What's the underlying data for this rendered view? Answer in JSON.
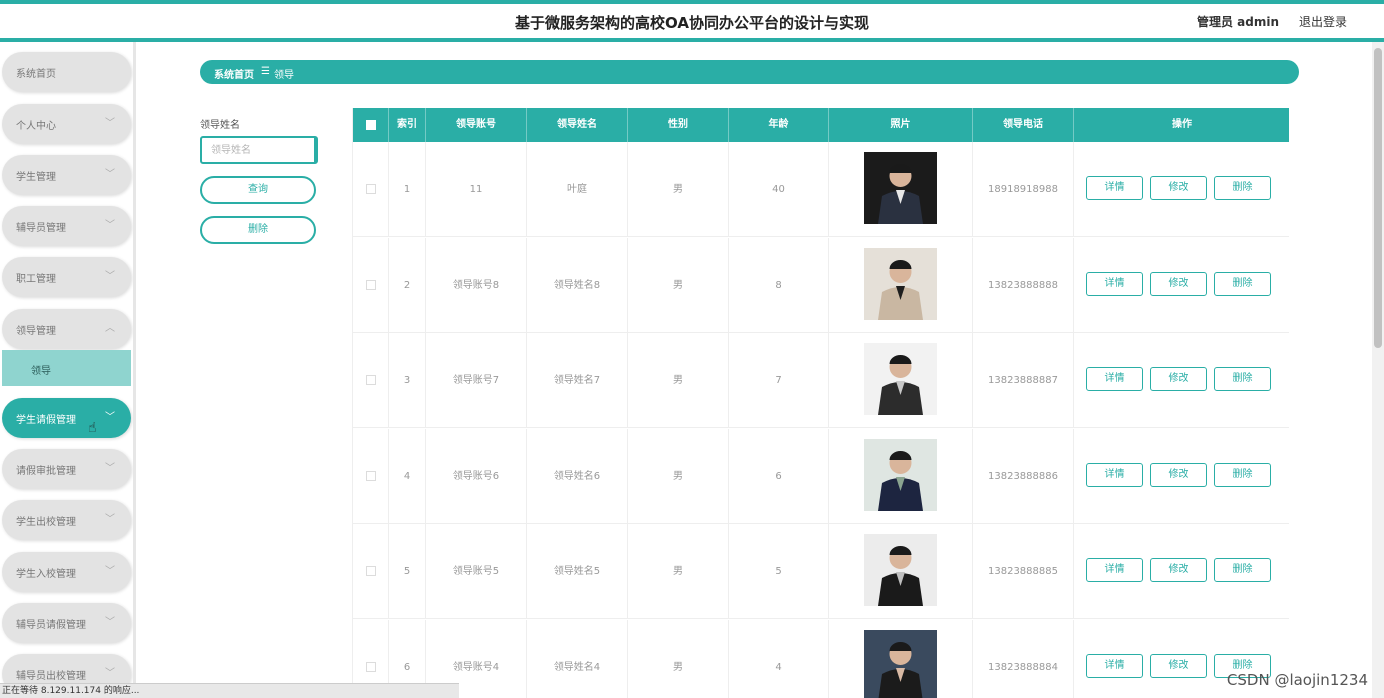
{
  "header": {
    "title": "基于微服务架构的高校OA协同办公平台的设计与实现",
    "user": "管理员 admin",
    "logout": "退出登录"
  },
  "sidebar": {
    "items": [
      {
        "label": "系统首页"
      },
      {
        "label": "个人中心"
      },
      {
        "label": "学生管理"
      },
      {
        "label": "辅导员管理"
      },
      {
        "label": "职工管理"
      },
      {
        "label": "领导管理"
      },
      {
        "label": "学生请假管理"
      },
      {
        "label": "请假审批管理"
      },
      {
        "label": "学生出校管理"
      },
      {
        "label": "学生入校管理"
      },
      {
        "label": "辅导员请假管理"
      },
      {
        "label": "辅导员出校管理"
      }
    ],
    "submenu": {
      "label": "领导"
    }
  },
  "breadcrumb": {
    "home": "系统首页",
    "separator": "☰",
    "current": "领导"
  },
  "search": {
    "label": "领导姓名",
    "placeholder": "领导姓名",
    "query_button": "查询",
    "delete_button": "删除"
  },
  "table": {
    "columns": [
      "索引",
      "领导账号",
      "领导姓名",
      "性别",
      "年龄",
      "照片",
      "领导电话",
      "操作"
    ],
    "actions": {
      "detail": "详情",
      "edit": "修改",
      "delete": "删除"
    },
    "rows": [
      {
        "index": "1",
        "account": "11",
        "name": "叶庭",
        "gender": "男",
        "age": "40",
        "phone": "18918918988"
      },
      {
        "index": "2",
        "account": "领导账号8",
        "name": "领导姓名8",
        "gender": "男",
        "age": "8",
        "phone": "13823888888"
      },
      {
        "index": "3",
        "account": "领导账号7",
        "name": "领导姓名7",
        "gender": "男",
        "age": "7",
        "phone": "13823888887"
      },
      {
        "index": "4",
        "account": "领导账号6",
        "name": "领导姓名6",
        "gender": "男",
        "age": "6",
        "phone": "13823888886"
      },
      {
        "index": "5",
        "account": "领导账号5",
        "name": "领导姓名5",
        "gender": "男",
        "age": "5",
        "phone": "13823888885"
      },
      {
        "index": "6",
        "account": "领导账号4",
        "name": "领导姓名4",
        "gender": "男",
        "age": "4",
        "phone": "13823888884"
      }
    ]
  },
  "statusbar": "正在等待 8.129.11.174 的响应...",
  "watermark": "CSDN @laojin1234",
  "colors": {
    "accent": "#2aaea6",
    "submenu": "#8fd4cf"
  }
}
